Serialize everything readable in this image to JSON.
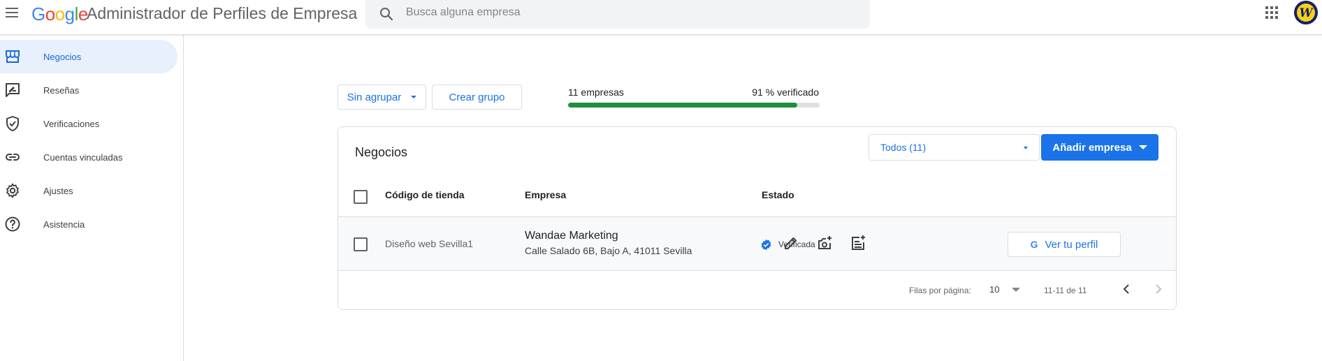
{
  "header": {
    "logo_letters": [
      {
        "char": "G",
        "color": "#4285f4"
      },
      {
        "char": "o",
        "color": "#ea4335"
      },
      {
        "char": "o",
        "color": "#fbbc05"
      },
      {
        "char": "g",
        "color": "#4285f4"
      },
      {
        "char": "l",
        "color": "#34a853"
      },
      {
        "char": "e",
        "color": "#ea4335"
      }
    ],
    "app_title": "Administrador de Perfiles de Empresa",
    "search_placeholder": "Busca alguna empresa",
    "avatar_letter": "W"
  },
  "sidebar": {
    "items": [
      {
        "label": "Negocios",
        "icon": "store-icon",
        "active": true
      },
      {
        "label": "Reseñas",
        "icon": "rate-review-icon",
        "active": false
      },
      {
        "label": "Verificaciones",
        "icon": "verified-shield-icon",
        "active": false
      },
      {
        "label": "Cuentas vinculadas",
        "icon": "link-icon",
        "active": false
      },
      {
        "label": "Ajustes",
        "icon": "gear-icon",
        "active": false
      },
      {
        "label": "Asistencia",
        "icon": "help-icon",
        "active": false
      }
    ]
  },
  "toolbar": {
    "group_label": "Sin agrupar",
    "create_group_label": "Crear grupo",
    "count_label": "11 empresas",
    "verified_label": "91 % verificado",
    "verified_fraction": 0.91
  },
  "card": {
    "title": "Negocios",
    "filter_label": "Todos (11)",
    "add_label": "Añadir empresa",
    "columns": {
      "code": "Código de tienda",
      "company": "Empresa",
      "status": "Estado"
    },
    "rows": [
      {
        "code": "Diseño web Sevilla1",
        "name": "Wandae Marketing",
        "address": "Calle Salado 6B, Bajo A, 41011 Sevilla",
        "status": "Verificada",
        "profile_label": "Ver tu perfil",
        "profile_icon_letter": "G"
      }
    ],
    "footer": {
      "rows_per_page_label": "Filas por página:",
      "rows_per_page_value": "10",
      "range": "11-11 de 11"
    }
  },
  "colors": {
    "accent": "#1a73e8",
    "progress": "#1e8e3e",
    "verified": "#1a73e8"
  }
}
